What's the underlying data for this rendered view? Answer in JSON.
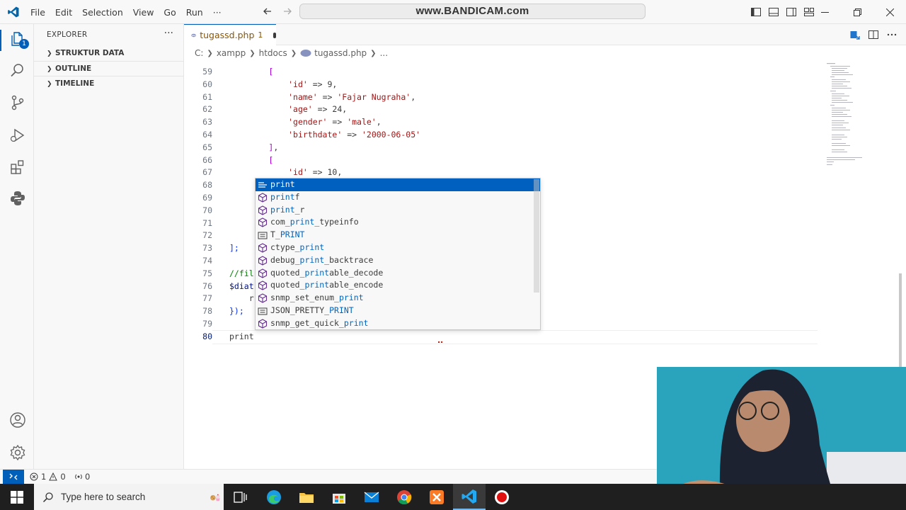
{
  "titlebar": {
    "menu": [
      "File",
      "Edit",
      "Selection",
      "View",
      "Go",
      "Run",
      "···"
    ],
    "command_center": "www.BANDICAM.com"
  },
  "activity_bar": {
    "explorer_badge": "1",
    "icons": [
      "files-icon",
      "search-icon",
      "source-control-icon",
      "run-debug-icon",
      "extensions-icon",
      "python-icon",
      "account-icon",
      "settings-gear-icon"
    ]
  },
  "sidebar": {
    "title": "EXPLORER",
    "more": "···",
    "sections": [
      "STRUKTUR DATA",
      "OUTLINE",
      "TIMELINE"
    ]
  },
  "tab": {
    "name": "tugassd.php",
    "problems": "1"
  },
  "breadcrumb": [
    "C:",
    "xampp",
    "htdocs",
    "tugassd.php",
    "..."
  ],
  "editor": {
    "lines": [
      {
        "num": "59",
        "text": "        ["
      },
      {
        "num": "60",
        "text": "            'id' => 9,"
      },
      {
        "num": "61",
        "text": "            'name' => 'Fajar Nugraha',"
      },
      {
        "num": "62",
        "text": "            'age' => 24,"
      },
      {
        "num": "63",
        "text": "            'gender' => 'male',"
      },
      {
        "num": "64",
        "text": "            'birthdate' => '2000-06-05'"
      },
      {
        "num": "65",
        "text": "        ],"
      },
      {
        "num": "66",
        "text": "        ["
      },
      {
        "num": "67",
        "text": "            'id' => 10,"
      },
      {
        "num": "68",
        "text": ""
      },
      {
        "num": "69",
        "text": ""
      },
      {
        "num": "70",
        "text": ""
      },
      {
        "num": "71",
        "text": ""
      },
      {
        "num": "72",
        "text": "        ]"
      },
      {
        "num": "73",
        "text": "];"
      },
      {
        "num": "74",
        "text": ""
      },
      {
        "num": "75",
        "text": "//fil"
      },
      {
        "num": "76",
        "text": "$diat"
      },
      {
        "num": "77",
        "text": "    r"
      },
      {
        "num": "78",
        "text": "});"
      },
      {
        "num": "79",
        "text": ""
      },
      {
        "num": "80",
        "text": "print"
      }
    ]
  },
  "suggestions": [
    {
      "pre": "",
      "hl": "print",
      "post": "",
      "kind": "keyword",
      "selected": true
    },
    {
      "pre": "",
      "hl": "print",
      "post": "f",
      "kind": "method",
      "selected": false
    },
    {
      "pre": "",
      "hl": "print",
      "post": "_r",
      "kind": "method",
      "selected": false
    },
    {
      "pre": "com_",
      "hl": "print",
      "post": "_typeinfo",
      "kind": "method",
      "selected": false
    },
    {
      "pre": "T_",
      "hl": "PRINT",
      "post": "",
      "kind": "constant",
      "selected": false
    },
    {
      "pre": "ctype_",
      "hl": "print",
      "post": "",
      "kind": "method",
      "selected": false
    },
    {
      "pre": "debug_",
      "hl": "print",
      "post": "_backtrace",
      "kind": "method",
      "selected": false
    },
    {
      "pre": "quoted_",
      "hl": "print",
      "post": "able_decode",
      "kind": "method",
      "selected": false
    },
    {
      "pre": "quoted_",
      "hl": "print",
      "post": "able_encode",
      "kind": "method",
      "selected": false
    },
    {
      "pre": "snmp_set_enum_",
      "hl": "print",
      "post": "",
      "kind": "method",
      "selected": false
    },
    {
      "pre": "JSON_PRETTY_",
      "hl": "PRINT",
      "post": "",
      "kind": "constant",
      "selected": false
    },
    {
      "pre": "snmp_get_quick_",
      "hl": "print",
      "post": "",
      "kind": "method",
      "selected": false
    }
  ],
  "statusbar": {
    "errors": "1",
    "warnings": "0",
    "ports": "0"
  },
  "taskbar": {
    "search_placeholder": "Type here to search",
    "apps": [
      "task-view",
      "edge",
      "file-explorer",
      "store",
      "mail",
      "chrome",
      "xampp",
      "vscode",
      "bandicam"
    ]
  },
  "colors": {
    "accent": "#005fb8",
    "selection": "#0060c0",
    "match_highlight": "#0066bf",
    "string": "#a31515",
    "taskbar": "#1f1f1f"
  }
}
